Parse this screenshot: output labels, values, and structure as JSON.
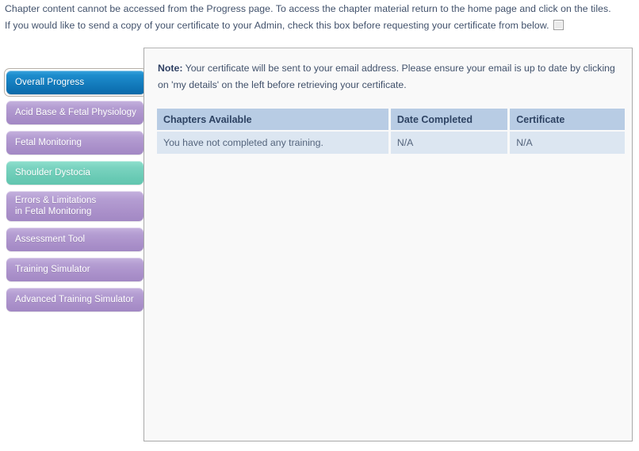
{
  "notices": {
    "line1": "Chapter content cannot be accessed from the Progress page.  To access the chapter material return to the home page and click on the tiles.",
    "line2": "If you would like to send a copy of your certificate to your Admin, check this box before requesting your certificate from below.",
    "checkbox_name": "send-copy-to-admin-checkbox",
    "checkbox_checked": false
  },
  "sidebar": {
    "items": [
      {
        "label": "Overall Progress",
        "name": "sidebar-item-overall-progress",
        "style": "blue",
        "active": true
      },
      {
        "label": "Acid Base & Fetal Physiology",
        "name": "sidebar-item-acid-base-fetal-physiology",
        "style": "purple",
        "active": false
      },
      {
        "label": "Fetal Monitoring",
        "name": "sidebar-item-fetal-monitoring",
        "style": "purple",
        "active": false
      },
      {
        "label": "Shoulder Dystocia",
        "name": "sidebar-item-shoulder-dystocia",
        "style": "teal",
        "active": false
      },
      {
        "label": "Errors & Limitations",
        "label_line2": "in Fetal Monitoring",
        "name": "sidebar-item-errors-limitations-in-fetal-monitoring",
        "style": "purple",
        "active": false
      },
      {
        "label": "Assessment Tool",
        "name": "sidebar-item-assessment-tool",
        "style": "purple",
        "active": false
      },
      {
        "label": "Training Simulator",
        "name": "sidebar-item-training-simulator",
        "style": "purple",
        "active": false
      },
      {
        "label": "Advanced Training Simulator",
        "name": "sidebar-item-advanced-training-simulator",
        "style": "purple",
        "active": false
      }
    ]
  },
  "note": {
    "label": "Note:",
    "text": " Your certificate will be sent to your email address. Please ensure your email is up to date by clicking on 'my details' on the left before retrieving your certificate."
  },
  "table": {
    "columns": [
      "Chapters Available",
      "Date Completed",
      "Certificate"
    ],
    "rows": [
      [
        "You have not completed any training.",
        "N/A",
        "N/A"
      ]
    ]
  },
  "colors": {
    "nav_active_blue": "#1d8ccd",
    "nav_purple": "#a98fc9",
    "nav_teal": "#69cab4",
    "table_header": "#b8cce4",
    "table_row": "#dce6f1",
    "text": "#41516b",
    "panel_bg": "#f9f9f9",
    "panel_border": "#a9a9a9"
  }
}
